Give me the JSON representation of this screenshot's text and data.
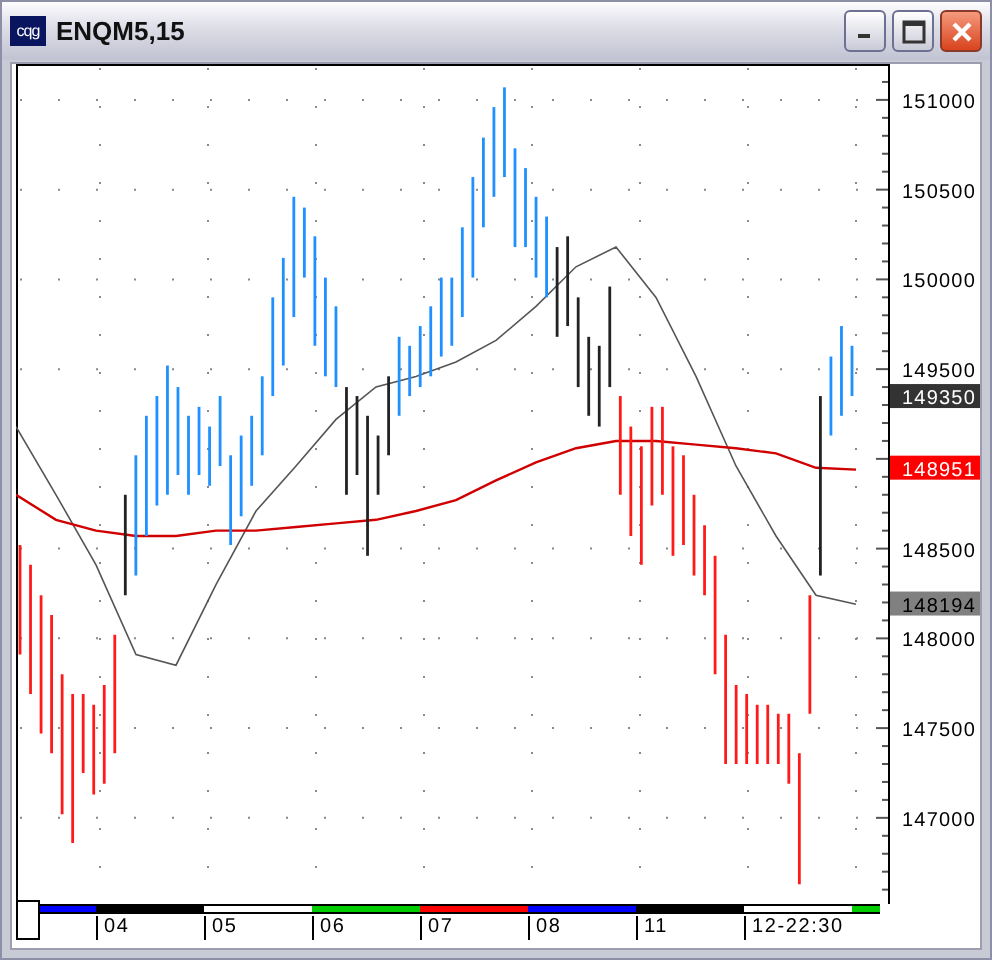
{
  "window": {
    "title": "ENQM5,15",
    "logo": "cqg"
  },
  "chart": {
    "chart_data": {
      "type": "line",
      "ylim": [
        146520,
        151200
      ],
      "yticks": [
        147000,
        147500,
        148000,
        148500,
        149500,
        150000,
        150500,
        151000
      ],
      "grid": true,
      "series": [
        {
          "color": "#555555",
          "values": [
            149180,
            148800,
            148410,
            147910,
            147850,
            148300,
            148710,
            148960,
            149220,
            149400,
            149460,
            149540,
            149660,
            149850,
            150070,
            150180,
            149900,
            149460,
            148960,
            148570,
            148240,
            148190
          ]
        },
        {
          "color": "#d00000",
          "values": [
            148800,
            148660,
            148600,
            148570,
            148570,
            148600,
            148600,
            148620,
            148640,
            148660,
            148710,
            148770,
            148880,
            148980,
            149060,
            149100,
            149100,
            149080,
            149060,
            149030,
            148950,
            148940
          ]
        }
      ]
    },
    "markers": [
      {
        "kind": "last",
        "text": "149350",
        "color": "#333333"
      },
      {
        "kind": "slow",
        "text": "148951",
        "color": "#ff0000"
      },
      {
        "kind": "fast",
        "text": "148194",
        "color": "#808080"
      }
    ]
  },
  "sessions": [
    {
      "color": "#0000ff"
    },
    {
      "label": "04",
      "color": "#000000"
    },
    {
      "label": "05",
      "color": "#ffffff"
    },
    {
      "label": "06",
      "color": "#00cc00"
    },
    {
      "label": "07",
      "color": "#ff0000"
    },
    {
      "label": "08",
      "color": "#0000ff"
    },
    {
      "label": "11",
      "color": "#000000"
    },
    {
      "label": "12-22:30",
      "color": "#ffffff"
    },
    {
      "color": "#00cc00"
    }
  ]
}
